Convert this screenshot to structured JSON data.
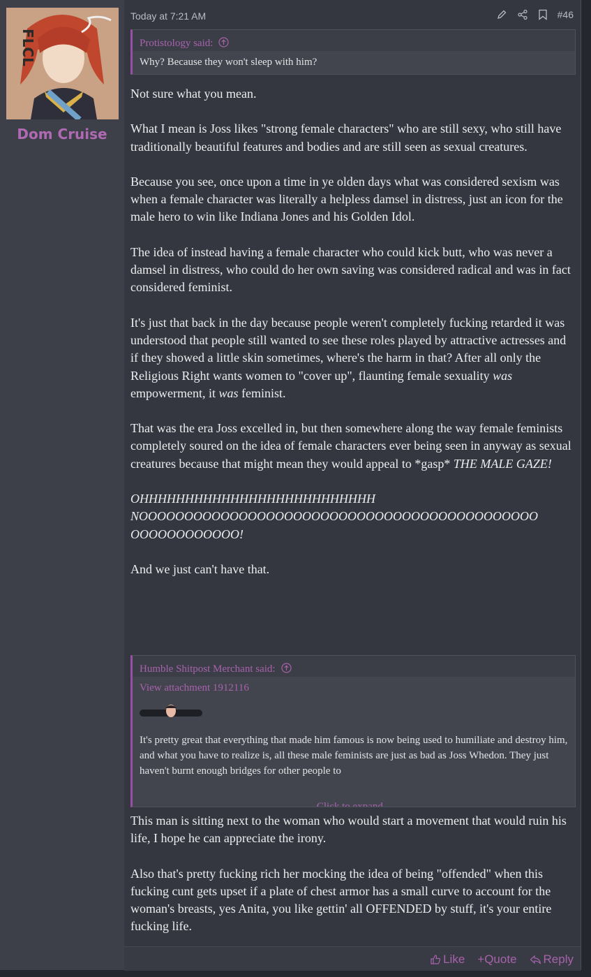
{
  "post": {
    "timestamp": "Today at 7:21 AM",
    "post_number": "#46",
    "username": "Dom Cruise",
    "avatar_label": "FLCL"
  },
  "quote1": {
    "author": "Protistology said:",
    "text": "Why? Because they won't sleep with him?"
  },
  "paragraphs1": [
    "Not sure what you mean.",
    "What I mean is Joss likes \"strong female characters\" who are still sexy, who still have traditionally beautiful features and bodies and are still seen as sexual creatures.",
    "Because you see, once upon a time in ye olden days what was considered sexism was when a female character was literally a helpless damsel in distress, just an icon for the male hero to win like Indiana Jones and his Golden Idol.",
    "The idea of instead having a female character who could kick butt, who was never a damsel in distress, who could do her own saving was considered radical and was in fact considered feminist."
  ],
  "p5": {
    "a": "It's just that back in the day because people weren't completely fucking retarded it was understood that people still wanted to see these roles played by attractive actresses and if they showed a little skin sometimes, where's the harm in that? After all only the Religious Right wants women to \"cover up\", flaunting female sexuality ",
    "b": "was",
    "c": " empowerment, it ",
    "d": "was",
    "e": " feminist."
  },
  "p6": {
    "a": "That was the era Joss excelled in, but then somewhere along the way female feminists completely soured on the idea of female characters ever being seen in anyway as sexual creatures because that might mean they would appeal to *gasp* ",
    "b": "THE MALE GAZE!"
  },
  "p7": {
    "line1": "OHHHHHHHHHHHHHHHHHHHHHHHHHH",
    "line2": "NOOOOOOOOOOOOOOOOOOOOOOOOOOOOOOOOOOOOOOOOOOOO",
    "line3": "OOOOOOOOOOOO!"
  },
  "p8": "And we just can't have that.",
  "quote2": {
    "author": "Humble Shitpost Merchant said:",
    "attachment": "View attachment 1912116",
    "text": "It's pretty great that everything that made him famous is now being used to humiliate and destroy him, and what you have to realize is, all these male feminists are just as bad as Joss Whedon. They just haven't burnt enough bridges for other people to",
    "expand": "Click to expand..."
  },
  "paragraphs2": [
    "This man is sitting next to the woman who would start a movement that would ruin his life, I hope he can appreciate the irony.",
    "Also that's pretty fucking rich her mocking the idea of being \"offended\" when this fucking cunt gets upset if a plate of chest armor has a small curve to account for the woman's breasts, yes Anita, you like gettin' all OFFENDED by stuff, it's your entire fucking life."
  ],
  "footer": {
    "like": "Like",
    "quote": "+Quote",
    "reply": "Reply"
  },
  "colors": {
    "accent": "#a762ad",
    "background": "#34373f",
    "text": "#ecedef"
  }
}
